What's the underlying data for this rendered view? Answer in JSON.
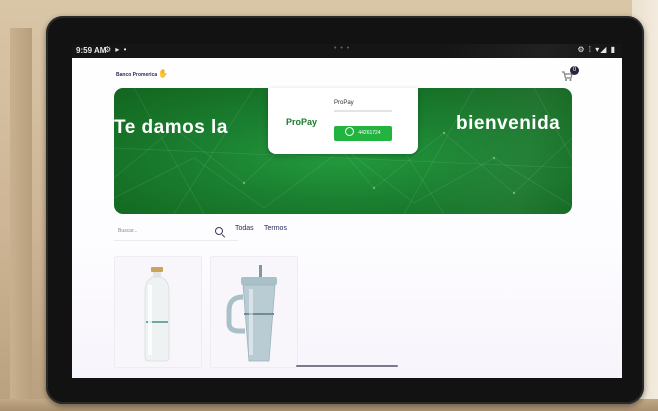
{
  "status_bar": {
    "time": "9:59 AM",
    "left_icons": "⚙ ▸ •",
    "center_dots": "• • •",
    "right_icons": "⚙ ⁞ ▾◢ ▮"
  },
  "header": {
    "brand": "Banco Promerica",
    "brand_icon": "hand-icon",
    "cart_icon": "cart-icon",
    "cart_count": "0"
  },
  "banner": {
    "title_left": "Te damos la",
    "title_right": "bienvenida",
    "color": "#1a7f30"
  },
  "popup": {
    "logo_pro": "Pro",
    "logo_pay": "Pay",
    "name": "ProPay",
    "whatsapp_icon": "whatsapp-icon",
    "whatsapp_number": "44261724",
    "whatsapp_color": "#23b43f"
  },
  "search": {
    "placeholder": "Buscar..."
  },
  "categories": [
    {
      "label": "Todas"
    },
    {
      "label": "Termos"
    }
  ],
  "products": [
    {
      "icon": "water-bottle-image"
    },
    {
      "icon": "tumbler-with-straw-image"
    }
  ]
}
